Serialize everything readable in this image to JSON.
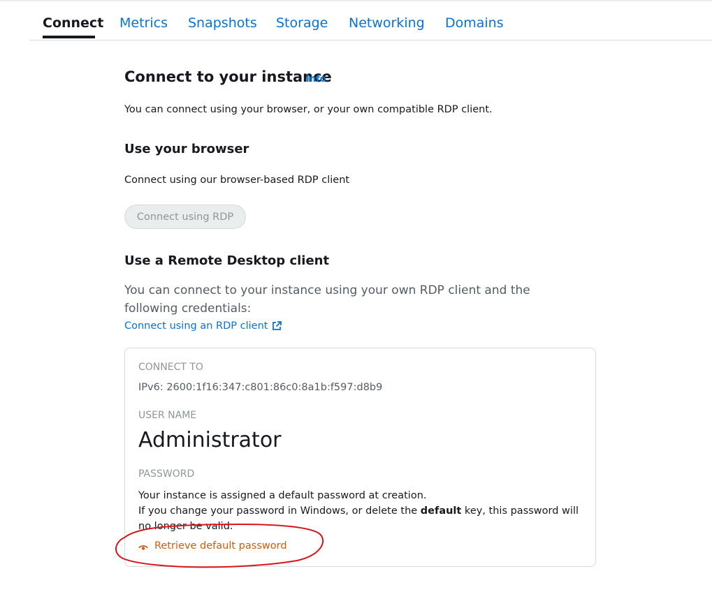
{
  "tabs": {
    "connect": "Connect",
    "metrics": "Metrics",
    "snapshots": "Snapshots",
    "storage": "Storage",
    "networking": "Networking",
    "domains": "Domains"
  },
  "section": {
    "title": "Connect to your instance",
    "info_link": "Info",
    "description": "You can connect using your browser, or your own compatible RDP client."
  },
  "browser": {
    "heading": "Use your browser",
    "description": "Connect using our browser-based RDP client",
    "button_label": "Connect using RDP"
  },
  "remote": {
    "heading": "Use a Remote Desktop client",
    "description": "You can connect to your instance using your own RDP client and the following credentials:",
    "link_label": "Connect using an RDP client"
  },
  "credentials": {
    "connect_to_label": "CONNECT TO",
    "connect_to_value": "IPv6: 2600:1f16:347:c801:86c0:8a1b:f597:d8b9",
    "username_label": "USER NAME",
    "username_value": "Administrator",
    "password_label": "PASSWORD",
    "password_line1": "Your instance is assigned a default password at creation.",
    "password_line2_pre": "If you change your password in Windows, or delete the ",
    "password_line2_bold": "default",
    "password_line2_post": " key, this password will no longer be valid.",
    "retrieve_label": "Retrieve default password"
  },
  "colors": {
    "link": "#0972d3",
    "retrieve": "#d45b07",
    "annotation": "#d8141c"
  },
  "icons": {
    "external_link": "external-link-icon",
    "eye": "eye-icon"
  }
}
